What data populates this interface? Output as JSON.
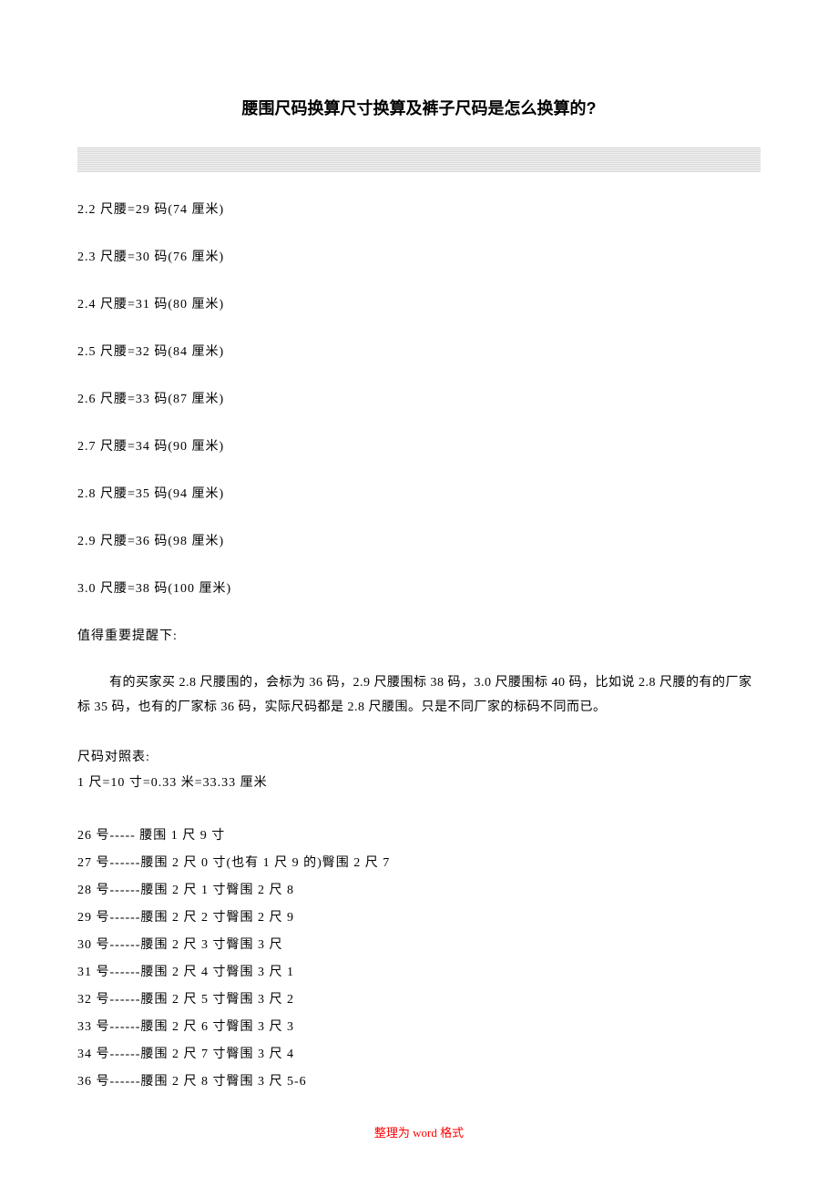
{
  "title": "腰围尺码换算尺寸换算及裤子尺码是怎么换算的?",
  "conversions": [
    "2.2 尺腰=29 码(74 厘米)",
    "2.3 尺腰=30 码(76 厘米)",
    "2.4 尺腰=31 码(80 厘米)",
    "2.5 尺腰=32 码(84 厘米)",
    "2.6 尺腰=33 码(87 厘米)",
    "2.7 尺腰=34 码(90 厘米)",
    "2.8 尺腰=35 码(94 厘米)",
    "2.9 尺腰=36 码(98 厘米)",
    "3.0 尺腰=38 码(100 厘米)"
  ],
  "note_heading": "值得重要提醒下:",
  "note_paragraph": "有的买家买 2.8 尺腰围的，会标为 36 码，2.9 尺腰围标 38 码，3.0 尺腰围标 40 码，比如说 2.8 尺腰的有的厂家标 35 码，也有的厂家标 36 码，实际尺码都是 2.8 尺腰围。只是不同厂家的标码不同而已。",
  "reference_heading": "尺码对照表:",
  "reference_line": "1 尺=10 寸=0.33 米=33.33 厘米",
  "size_rows": [
    "26 号----- 腰围 1 尺 9 寸",
    "27 号------腰围 2 尺 0 寸(也有 1 尺 9 的)臀围 2 尺 7",
    "28 号------腰围 2 尺 1 寸臀围 2 尺 8",
    "29 号------腰围 2 尺 2 寸臀围 2 尺 9",
    "30 号------腰围 2 尺 3 寸臀围 3 尺",
    "31 号------腰围 2 尺 4 寸臀围 3 尺 1",
    "32 号------腰围 2 尺 5 寸臀围 3 尺 2",
    "33 号------腰围 2 尺 6 寸臀围 3 尺 3",
    "34 号------腰围 2 尺 7 寸臀围 3 尺 4",
    "36 号------腰围 2 尺 8 寸臀围 3 尺 5-6"
  ],
  "footer_prefix": "整理为",
  "footer_word": " word ",
  "footer_suffix": "格式"
}
